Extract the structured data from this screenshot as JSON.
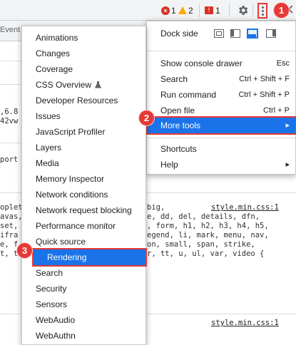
{
  "toolbar": {
    "errors": "1",
    "warnings": "2",
    "issues": "1",
    "event_tab_label": "Event"
  },
  "menu": {
    "dock_side_label": "Dock side",
    "items": [
      {
        "label": "Show console drawer",
        "shortcut": "Esc"
      },
      {
        "label": "Search",
        "shortcut": "Ctrl + Shift + F"
      },
      {
        "label": "Run command",
        "shortcut": "Ctrl + Shift + P"
      },
      {
        "label": "Open file",
        "shortcut": "Ctrl + P"
      },
      {
        "label": "More tools",
        "shortcut": "▸"
      },
      {
        "label": "Shortcuts",
        "shortcut": ""
      },
      {
        "label": "Help",
        "shortcut": "▸"
      }
    ]
  },
  "submenu": {
    "items": [
      "Animations",
      "Changes",
      "Coverage",
      "CSS Overview",
      "Developer Resources",
      "Issues",
      "JavaScript Profiler",
      "Layers",
      "Media",
      "Memory Inspector",
      "Network conditions",
      "Network request blocking",
      "Performance monitor",
      "Quick source",
      "Rendering",
      "Search",
      "Security",
      "Sensors",
      "WebAudio",
      "WebAuthn"
    ]
  },
  "steps": [
    "1",
    "2",
    "3"
  ],
  "background": {
    "line1": ",6.8",
    "line2": "42vw",
    "line3": "port",
    "line4": "oplet",
    "line5": "avas,",
    "line6": "set,",
    "line7": "ifra",
    "line8": "e, f",
    "line9": "t, t",
    "css1_right": "big,",
    "css1_link": "style.min.css:1",
    "css2": "e, dd, del, details, dfn,",
    "css3": ", form, h1, h2, h3, h4, h5,",
    "css4": "egend, li, mark, menu, nav,",
    "css5": "on, small, span, strike,",
    "css6": "r, tt, u, ul, var, video {",
    "css_link2": "style.min.css:1"
  },
  "colors": {
    "accent": "#1a73e8",
    "annotation": "#e53935"
  }
}
